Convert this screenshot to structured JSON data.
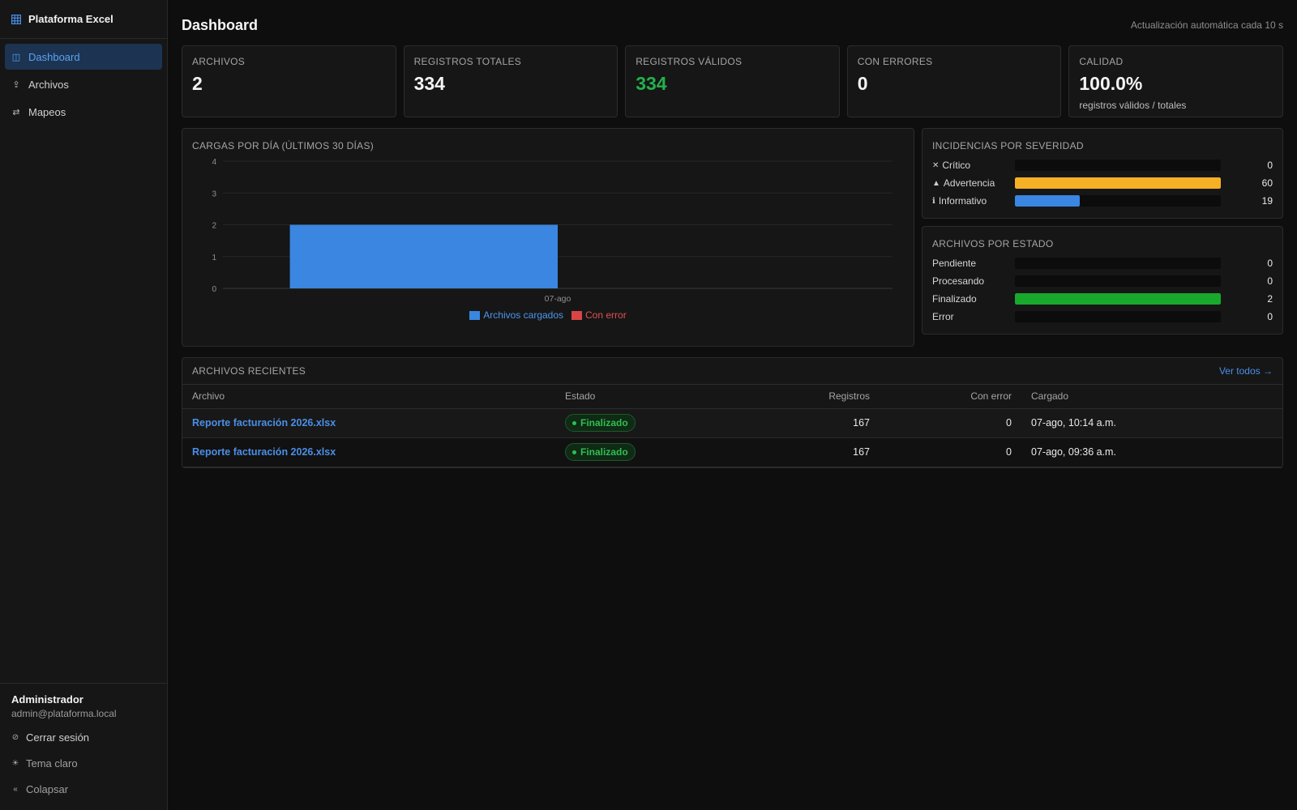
{
  "app": {
    "brand": "Plataforma Excel",
    "brand_icon": "grid-icon"
  },
  "sidebar": {
    "items": [
      {
        "label": "Dashboard",
        "icon": "dashboard-icon",
        "active": true
      },
      {
        "label": "Archivos",
        "icon": "file-icon",
        "active": false
      },
      {
        "label": "Mapeos",
        "icon": "arrows-icon",
        "active": false
      }
    ],
    "user": {
      "name": "Administrador",
      "email": "admin@plataforma.local"
    },
    "footer": {
      "logout": "Cerrar sesión",
      "theme": "Tema claro",
      "collapse": "Colapsar"
    }
  },
  "header": {
    "title": "Dashboard",
    "refresh_note": "Actualización automática cada 10 s"
  },
  "stats": [
    {
      "label": "ARCHIVOS",
      "value": "2"
    },
    {
      "label": "REGISTROS TOTALES",
      "value": "334"
    },
    {
      "label": "REGISTROS VÁLIDOS",
      "value": "334"
    },
    {
      "label": "CON ERRORES",
      "value": "0"
    },
    {
      "label": "CALIDAD",
      "value": "100.0%",
      "sub": "registros válidos / totales"
    }
  ],
  "uploads_chart": {
    "title": "CARGAS POR DÍA (ÚLTIMOS 30 DÍAS)"
  },
  "chart_data": {
    "type": "bar",
    "categories": [
      "07-ago"
    ],
    "series": [
      {
        "name": "Archivos cargados",
        "values": [
          2
        ],
        "color": "#3a86e0"
      },
      {
        "name": "Con error",
        "values": [
          0
        ],
        "color": "#d94545"
      }
    ],
    "ylim": [
      0,
      4
    ],
    "yticks": [
      0,
      1,
      2,
      3,
      4
    ],
    "legend": "bottom",
    "grid": true
  },
  "severity": {
    "title": "INCIDENCIAS POR SEVERIDAD",
    "max": 60,
    "rows": [
      {
        "icon": "close-icon",
        "glyph": "✕",
        "label": "Crítico",
        "count": 0,
        "color": "#d94545"
      },
      {
        "icon": "warning-icon",
        "glyph": "▲",
        "label": "Advertencia",
        "count": 60,
        "color": "#f5b025"
      },
      {
        "icon": "info-icon",
        "glyph": "ℹ",
        "label": "Informativo",
        "count": 19,
        "color": "#3a86e0"
      }
    ]
  },
  "status": {
    "title": "ARCHIVOS POR ESTADO",
    "max": 2,
    "rows": [
      {
        "label": "Pendiente",
        "count": 0,
        "color": "#888888"
      },
      {
        "label": "Procesando",
        "count": 0,
        "color": "#3a86e0"
      },
      {
        "label": "Finalizado",
        "count": 2,
        "color": "#18a82b"
      },
      {
        "label": "Error",
        "count": 0,
        "color": "#d94545"
      }
    ]
  },
  "recent": {
    "title": "ARCHIVOS RECIENTES",
    "see_all": "Ver todos →",
    "columns": [
      "Archivo",
      "Estado",
      "Registros",
      "Con error",
      "Cargado"
    ],
    "rows": [
      {
        "file": "Reporte facturación 2026.xlsx",
        "status": "Finalizado",
        "records": "167",
        "errors": "0",
        "uploaded": "07-ago, 10:14 a.m."
      },
      {
        "file": "Reporte facturación 2026.xlsx",
        "status": "Finalizado",
        "records": "167",
        "errors": "0",
        "uploaded": "07-ago, 09:36 a.m."
      }
    ]
  }
}
